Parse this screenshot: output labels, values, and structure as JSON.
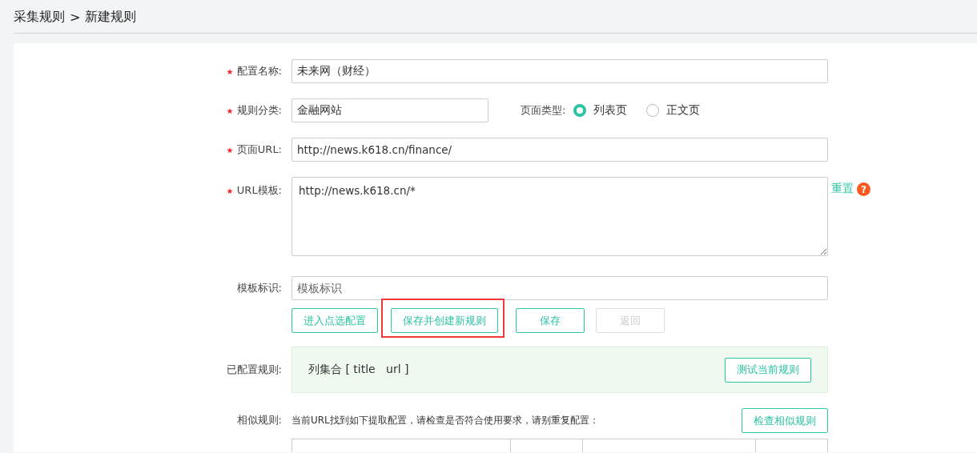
{
  "breadcrumb": {
    "parent": "采集规则",
    "separator": ">",
    "current": "新建规则"
  },
  "form": {
    "name": {
      "label": "配置名称:",
      "required": true,
      "value": "未来网（财经）"
    },
    "category": {
      "label": "规则分类:",
      "required": true,
      "value": "金融网站"
    },
    "page_type": {
      "label": "页面类型:",
      "options": [
        {
          "label": "列表页",
          "selected": true
        },
        {
          "label": "正文页",
          "selected": false
        }
      ]
    },
    "page_url": {
      "label": "页面URL:",
      "required": true,
      "value": "http://news.k618.cn/finance/"
    },
    "url_template": {
      "label": "URL模板:",
      "required": true,
      "value": "http://news.k618.cn/*",
      "reset_link": "重置",
      "help_icon": "?"
    },
    "template_id": {
      "label": "模板标识:",
      "required": false,
      "placeholder": "模板标识"
    },
    "buttons": [
      {
        "label": "进入点选配置",
        "disabled": false,
        "highlighted": false
      },
      {
        "label": "保存并创建新规则",
        "disabled": false,
        "highlighted": true
      },
      {
        "label": "保存",
        "disabled": false,
        "highlighted": false
      },
      {
        "label": "返回",
        "disabled": true,
        "highlighted": false
      }
    ],
    "configured": {
      "label": "已配置规则:",
      "text": "列集合 [ title   url ]",
      "button": "测试当前规则"
    },
    "similar": {
      "label": "相似规则:",
      "hint": "当前URL找到如下提取配置，请检查是否符合使用要求，请别重复配置：",
      "button": "检查相似规则"
    }
  }
}
